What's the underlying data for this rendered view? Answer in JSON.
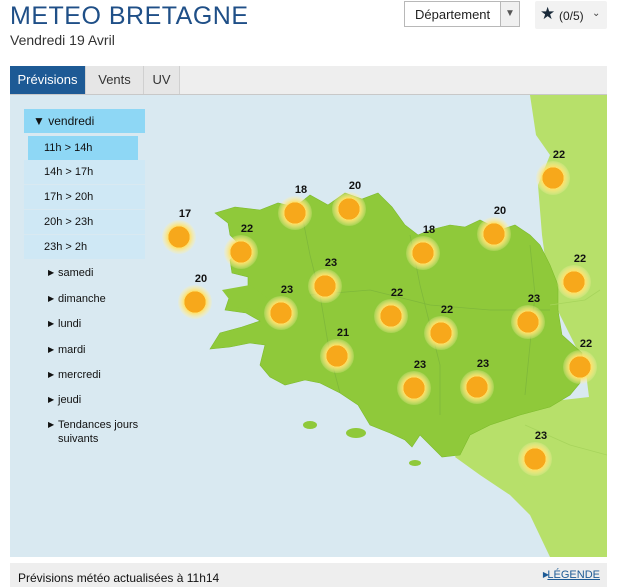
{
  "header": {
    "title": "METEO BRETAGNE",
    "date": "Vendredi 19 Avril",
    "department_select": "Département",
    "favorites_count": "(0/5)"
  },
  "tabs": [
    {
      "label": "Prévisions",
      "active": true
    },
    {
      "label": "Vents",
      "active": false
    },
    {
      "label": "UV",
      "active": false
    }
  ],
  "sidebar": {
    "current_day": "vendredi",
    "slots": [
      "11h > 14h",
      "14h > 17h",
      "17h > 20h",
      "20h > 23h",
      "23h > 2h"
    ],
    "selected_slot": "11h > 14h",
    "other_days": [
      "samedi",
      "dimanche",
      "lundi",
      "mardi",
      "mercredi",
      "jeudi",
      "Tendances jours suivants"
    ]
  },
  "map": {
    "temperatures": [
      "17",
      "22",
      "18",
      "20",
      "18",
      "20",
      "22",
      "22",
      "20",
      "23",
      "23",
      "22",
      "22",
      "23",
      "21",
      "23",
      "23",
      "22",
      "23"
    ],
    "weather_icon": "sun-icon",
    "colors": {
      "sea": "#d9e9f1",
      "land_brittany": "#8fc93a",
      "land_outside": "#b7e06a",
      "sun": "#f7a81b"
    }
  },
  "footer": {
    "status": "Prévisions météo actualisées à 11h14",
    "legend": "LÉGENDE"
  }
}
